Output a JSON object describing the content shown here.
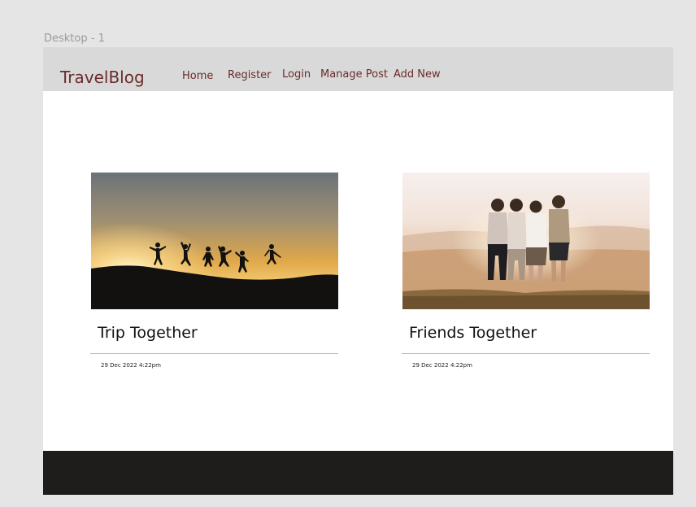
{
  "canvas": {
    "frame_label": "Desktop - 1"
  },
  "navbar": {
    "brand": "TravelBlog",
    "links": [
      "Home",
      "Register",
      "Login",
      "Manage Post",
      "Add New"
    ]
  },
  "posts": [
    {
      "title": "Trip Together",
      "date": "29 Dec 2022 4:22pm",
      "image": "sunset silhouettes of people jumping on a hill"
    },
    {
      "title": "Friends Together",
      "date": "29 Dec 2022 4:22pm",
      "image": "group of friends hugging facing sunset over mountains"
    }
  ],
  "colors": {
    "page_bg": "#e5e5e5",
    "navbar_bg": "#d9d9d9",
    "nav_text": "#6b2b2b",
    "footer_bg": "#1f1c1c"
  }
}
